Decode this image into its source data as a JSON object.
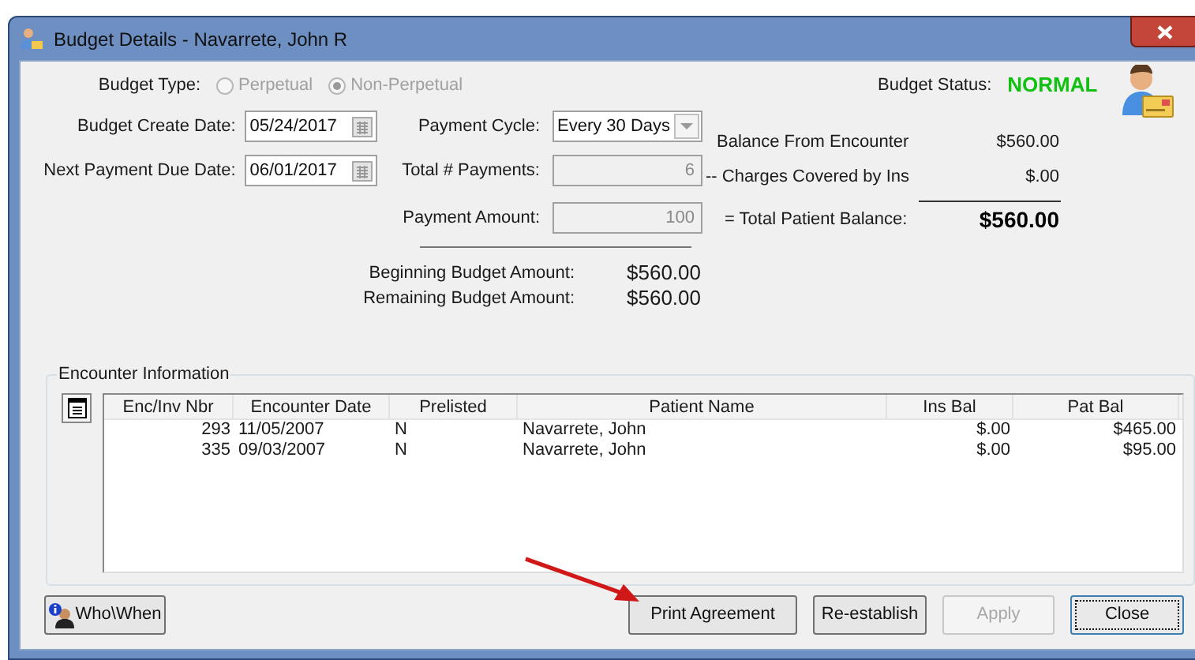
{
  "window": {
    "title": "Budget Details - Navarrete, John R"
  },
  "budget_type": {
    "label": "Budget Type:",
    "options": [
      {
        "label": "Perpetual",
        "selected": false,
        "disabled": true
      },
      {
        "label": "Non-Perpetual",
        "selected": true,
        "disabled": true
      }
    ]
  },
  "budget_status": {
    "label": "Budget Status:",
    "value": "NORMAL"
  },
  "form_rows": [
    {
      "left": {
        "label": "Budget Create Date:",
        "value": "05/24/2017",
        "kind": "date"
      },
      "right": {
        "label": "Payment Cycle:",
        "value": "Every 30 Days",
        "kind": "dropdown",
        "disabled": false
      }
    },
    {
      "left": {
        "label": "Next Payment Due Date:",
        "value": "06/01/2017",
        "kind": "date"
      },
      "right": {
        "label": "Total # Payments:",
        "value": "6",
        "kind": "number",
        "disabled": true
      }
    },
    {
      "right": {
        "label": "Payment Amount:",
        "value": "100",
        "kind": "number",
        "disabled": true
      }
    }
  ],
  "budget_amounts": [
    {
      "label": "Beginning Budget Amount:",
      "value": "$560.00"
    },
    {
      "label": "Remaining Budget Amount:",
      "value": "$560.00"
    }
  ],
  "balance": [
    {
      "label": "Balance From Encounter",
      "value": "$560.00",
      "kind": "line"
    },
    {
      "label": "-- Charges Covered by Ins",
      "value": "$.00",
      "kind": "line"
    },
    {
      "label": "= Total Patient Balance:",
      "value": "$560.00",
      "kind": "total"
    }
  ],
  "encounters": {
    "title": "Encounter Information",
    "columns": [
      "Enc/Inv Nbr",
      "Encounter Date",
      "Prelisted",
      "Patient Name",
      "Ins Bal",
      "Pat Bal"
    ],
    "rows": [
      [
        "293",
        "11/05/2007",
        "N",
        "Navarrete, John",
        "$.00",
        "$465.00"
      ],
      [
        "335",
        "09/03/2007",
        "N",
        "Navarrete, John",
        "$.00",
        "$95.00"
      ]
    ]
  },
  "buttons": [
    {
      "label": "Who\\When",
      "kind": "info",
      "disabled": false,
      "focused": false
    },
    {
      "label": "Print Agreement",
      "kind": "plain",
      "disabled": false,
      "focused": false
    },
    {
      "label": "Re-establish",
      "kind": "plain",
      "disabled": false,
      "focused": false
    },
    {
      "label": "Apply",
      "kind": "plain",
      "disabled": true,
      "focused": false
    },
    {
      "label": "Close",
      "kind": "plain",
      "disabled": false,
      "focused": true
    }
  ]
}
